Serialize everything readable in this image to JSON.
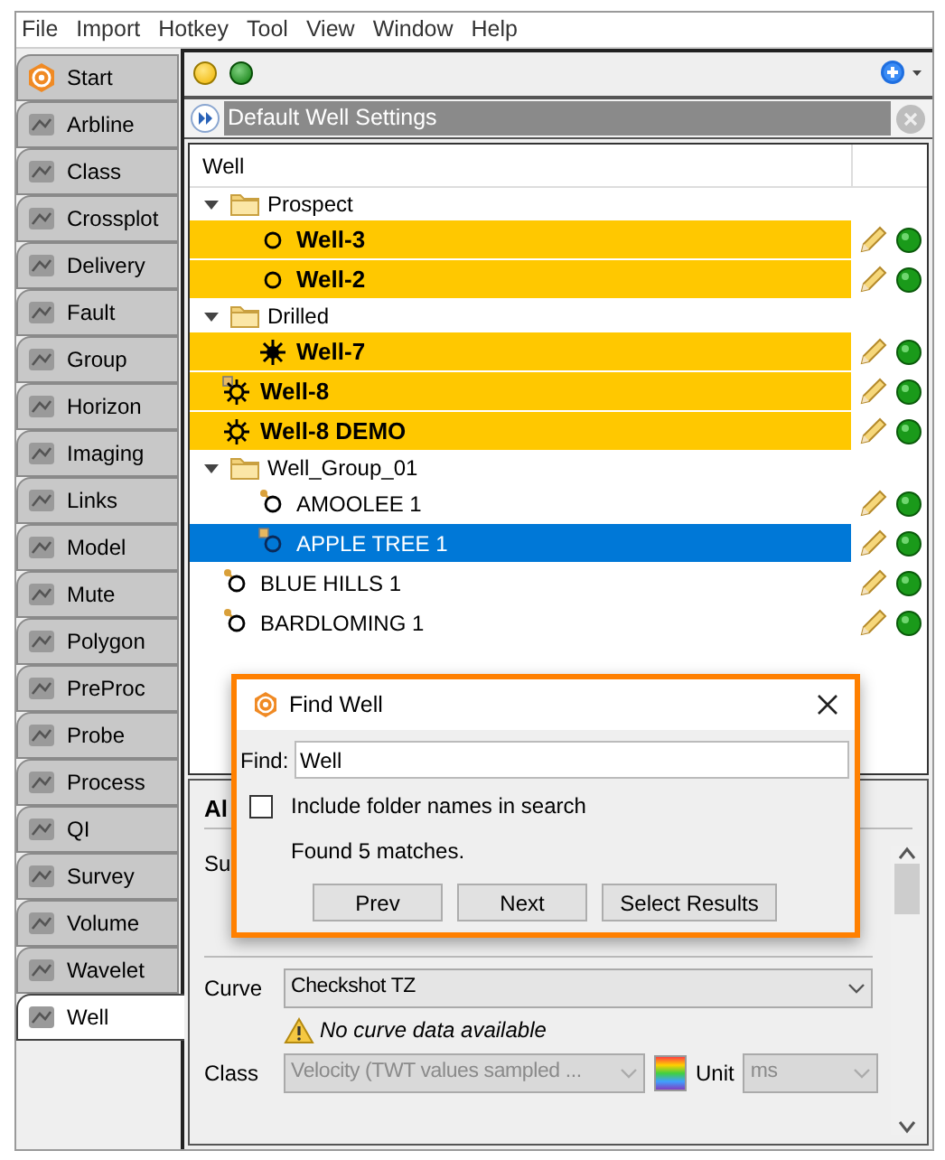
{
  "menu": [
    "File",
    "Import",
    "Hotkey",
    "Tool",
    "View",
    "Window",
    "Help"
  ],
  "tabs": [
    {
      "label": "Start",
      "selected": false
    },
    {
      "label": "Arbline",
      "selected": false
    },
    {
      "label": "Class",
      "selected": false
    },
    {
      "label": "Crossplot",
      "selected": false
    },
    {
      "label": "Delivery",
      "selected": false
    },
    {
      "label": "Fault",
      "selected": false
    },
    {
      "label": "Group",
      "selected": false
    },
    {
      "label": "Horizon",
      "selected": false
    },
    {
      "label": "Imaging",
      "selected": false
    },
    {
      "label": "Links",
      "selected": false
    },
    {
      "label": "Model",
      "selected": false
    },
    {
      "label": "Mute",
      "selected": false
    },
    {
      "label": "Polygon",
      "selected": false
    },
    {
      "label": "PreProc",
      "selected": false
    },
    {
      "label": "Probe",
      "selected": false
    },
    {
      "label": "Process",
      "selected": false
    },
    {
      "label": "QI",
      "selected": false
    },
    {
      "label": "Survey",
      "selected": false
    },
    {
      "label": "Volume",
      "selected": false
    },
    {
      "label": "Wavelet",
      "selected": false
    },
    {
      "label": "Well",
      "selected": true
    }
  ],
  "settings_bar": {
    "title": "Default Well Settings"
  },
  "tree": {
    "header": "Well",
    "items": [
      {
        "kind": "folder",
        "label": "Prospect",
        "expanded": true,
        "children": [
          {
            "kind": "circle",
            "label": "Well-3",
            "highlighted": true,
            "selected": false
          },
          {
            "kind": "circle",
            "label": "Well-2",
            "highlighted": true,
            "selected": false
          }
        ]
      },
      {
        "kind": "folder",
        "label": "Drilled",
        "expanded": true,
        "children": [
          {
            "kind": "burst",
            "label": "Well-7",
            "highlighted": true,
            "selected": false
          }
        ]
      },
      {
        "kind": "sun-tagged",
        "label": "Well-8",
        "highlighted": true,
        "selected": false
      },
      {
        "kind": "sun",
        "label": "Well-8 DEMO",
        "highlighted": true,
        "selected": false
      },
      {
        "kind": "folder",
        "label": "Well_Group_01",
        "expanded": true,
        "children": [
          {
            "kind": "circle-keyed",
            "label": "AMOOLEE 1",
            "highlighted": false,
            "selected": false
          },
          {
            "kind": "circle-tagged",
            "label": "APPLE TREE 1",
            "highlighted": false,
            "selected": true
          }
        ]
      },
      {
        "kind": "circle-keyed",
        "label": "BLUE HILLS 1",
        "highlighted": false,
        "selected": false
      },
      {
        "kind": "circle-keyed",
        "label": "BARDLOMING 1",
        "highlighted": false,
        "selected": false
      }
    ]
  },
  "details": {
    "heading": "Al",
    "label_1": "Su",
    "curve": {
      "label": "Curve",
      "value": "Checkshot TZ"
    },
    "warning": "No curve data available",
    "class": {
      "label": "Class",
      "value": "Velocity (TWT values sampled ...",
      "disabled": true
    },
    "unit": {
      "label": "Unit",
      "value": "ms",
      "disabled": true
    }
  },
  "find_dialog": {
    "title": "Find Well",
    "find_label": "Find:",
    "value": "Well",
    "include_folders": {
      "label": "Include folder names in search",
      "checked": false
    },
    "status": "Found 5 matches.",
    "buttons": [
      "Prev",
      "Next",
      "Select Results"
    ]
  }
}
